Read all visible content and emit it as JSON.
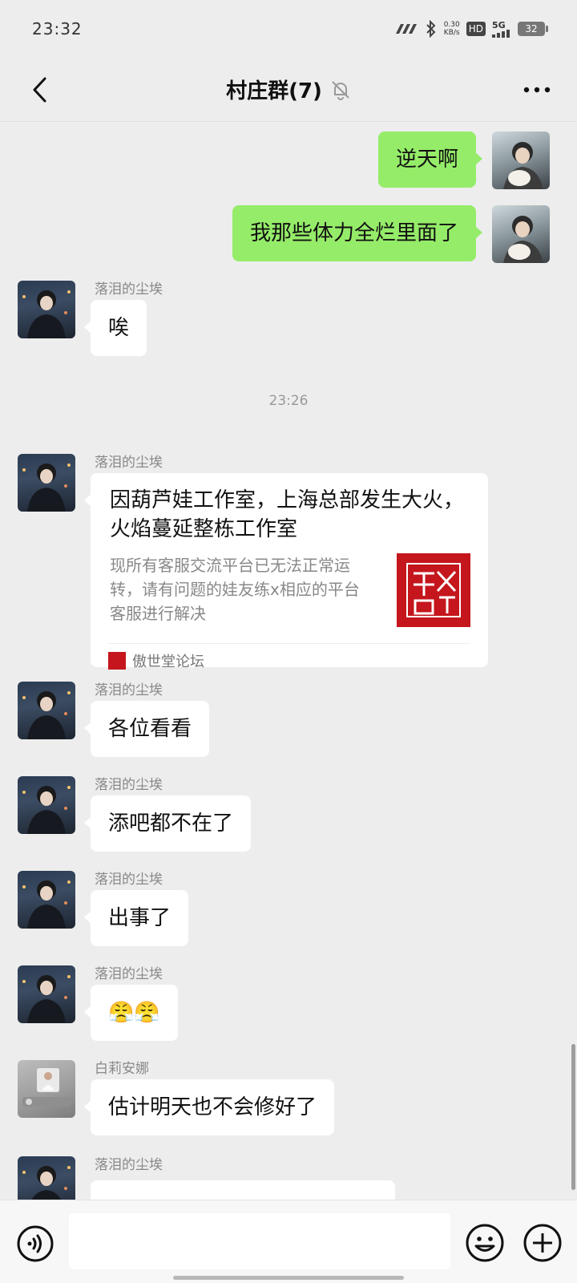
{
  "status_bar": {
    "time": "23:32",
    "signal_label": "5G",
    "speed_value": "0.30",
    "speed_unit": "KB/s",
    "hd_label": "HD",
    "battery_level": "32"
  },
  "header": {
    "title": "村庄群(7)",
    "back_icon": "chevron-left-icon",
    "mute_icon": "bell-off-icon",
    "more_icon": "more-horizontal-icon"
  },
  "messages": [
    {
      "side": "right",
      "text": "逆天啊"
    },
    {
      "side": "right",
      "text": "我那些体力全烂里面了"
    },
    {
      "side": "left",
      "sender": "落泪的尘埃",
      "text": "唉"
    },
    {
      "side": "left",
      "sender": "落泪的尘埃",
      "text": "各位看看"
    },
    {
      "side": "left",
      "sender": "落泪的尘埃",
      "text": "添吧都不在了"
    },
    {
      "side": "left",
      "sender": "落泪的尘埃",
      "text": "出事了"
    },
    {
      "side": "left",
      "sender": "落泪的尘埃",
      "text": "😤😤"
    },
    {
      "side": "left",
      "sender": "白莉安娜",
      "text": "估计明天也不会修好了"
    },
    {
      "side": "left",
      "sender": "落泪的尘埃",
      "text": ""
    }
  ],
  "time_separator": "23:26",
  "link_card": {
    "sender": "落泪的尘埃",
    "title": "因葫芦娃工作室，上海总部发生大火，火焰蔓延整栋工作室",
    "description": "现所有客服交流平台已无法正常运转，请有问题的娃友练x相应的平台客服进行解决",
    "source": "傲世堂论坛",
    "thumb_text": "傲世堂"
  },
  "input_bar": {
    "placeholder": "",
    "voice_icon": "voice-icon",
    "emoji_icon": "emoji-icon",
    "plus_icon": "plus-circle-icon"
  },
  "colors": {
    "background": "#ededed",
    "my_bubble": "#95ec69",
    "other_bubble": "#ffffff",
    "brand_red": "#c4161c"
  }
}
